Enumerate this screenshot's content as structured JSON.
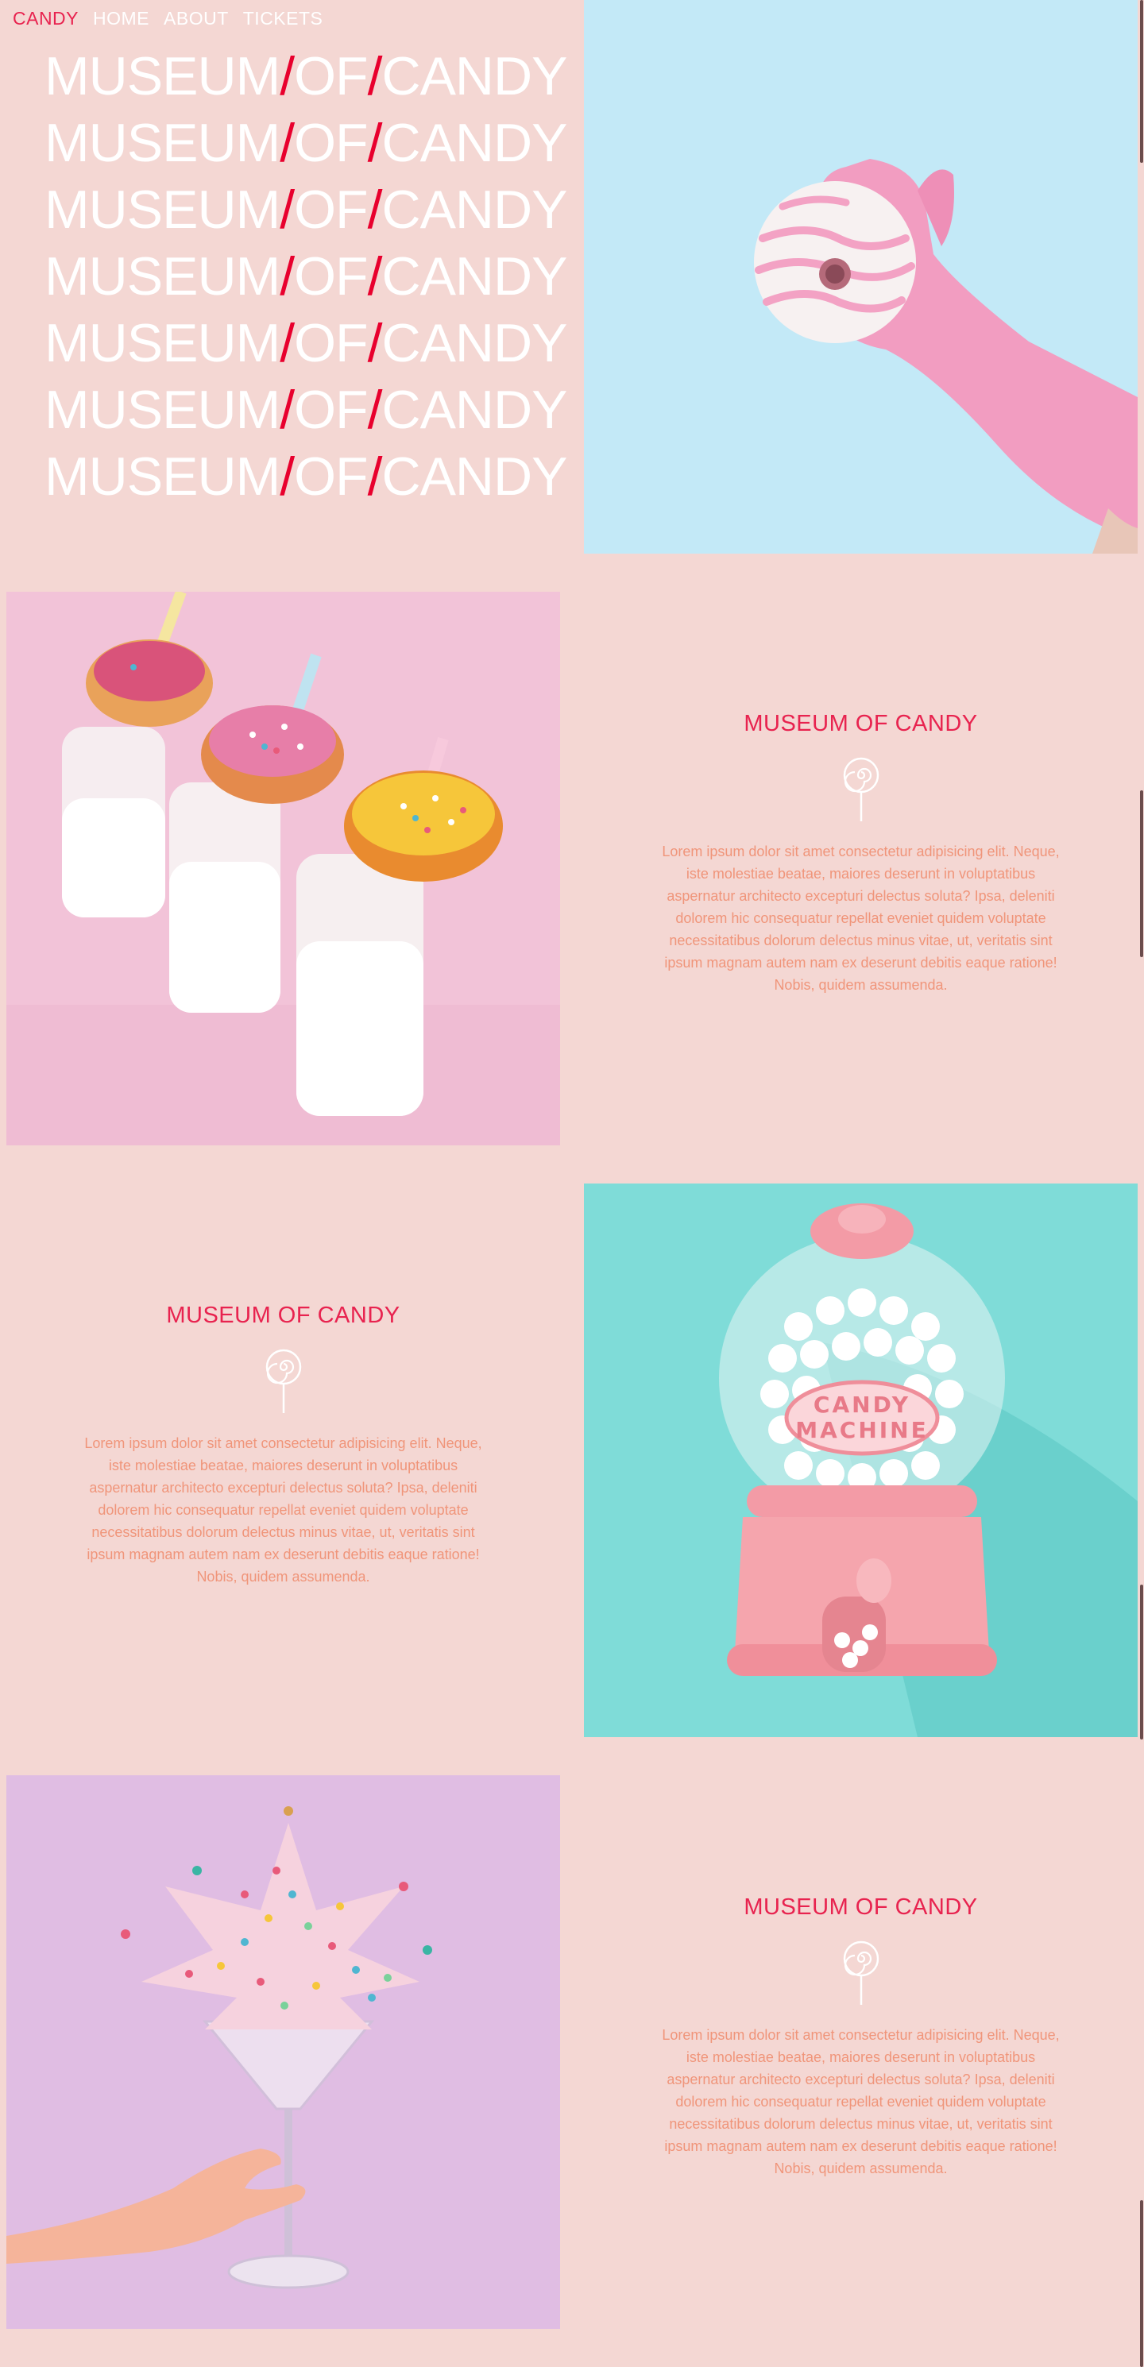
{
  "nav": {
    "brand": "CANDY",
    "links": [
      "HOME",
      "ABOUT",
      "TICKETS"
    ]
  },
  "hero": {
    "word1": "MUSEUM",
    "slash": "/",
    "word2": "OF",
    "word3": "CANDY"
  },
  "sections": [
    {
      "title": "MUSEUM OF CANDY",
      "body": "Lorem ipsum dolor sit amet consectetur adipisicing elit. Neque, iste molestiae beatae, maiores deserunt in voluptatibus aspernatur architecto excepturi delectus soluta? Ipsa, deleniti dolorem hic consequatur repellat eveniet quidem voluptate necessitatibus dolorum delectus minus vitae, ut, veritatis sint ipsum magnam autem nam ex deserunt debitis eaque ratione! Nobis, quidem assumenda."
    },
    {
      "title": "MUSEUM OF CANDY",
      "body": "Lorem ipsum dolor sit amet consectetur adipisicing elit. Neque, iste molestiae beatae, maiores deserunt in voluptatibus aspernatur architecto excepturi delectus soluta? Ipsa, deleniti dolorem hic consequatur repellat eveniet quidem voluptate necessitatibus dolorum delectus minus vitae, ut, veritatis sint ipsum magnam autem nam ex deserunt debitis eaque ratione! Nobis, quidem assumenda."
    },
    {
      "title": "MUSEUM OF CANDY",
      "body": "Lorem ipsum dolor sit amet consectetur adipisicing elit. Neque, iste molestiae beatae, maiores deserunt in voluptatibus aspernatur architecto excepturi delectus soluta? Ipsa, deleniti dolorem hic consequatur repellat eveniet quidem voluptate necessitatibus dolorum delectus minus vitae, ut, veritatis sint ipsum magnam autem nam ex deserunt debitis eaque ratione! Nobis, quidem assumenda."
    }
  ],
  "gumball_label": [
    "CANDY",
    "MACHINE"
  ],
  "colors": {
    "page_bg": "#f4d7d3",
    "accent": "#e8234f",
    "slash": "#e8002d",
    "body_text": "#f0957a"
  }
}
